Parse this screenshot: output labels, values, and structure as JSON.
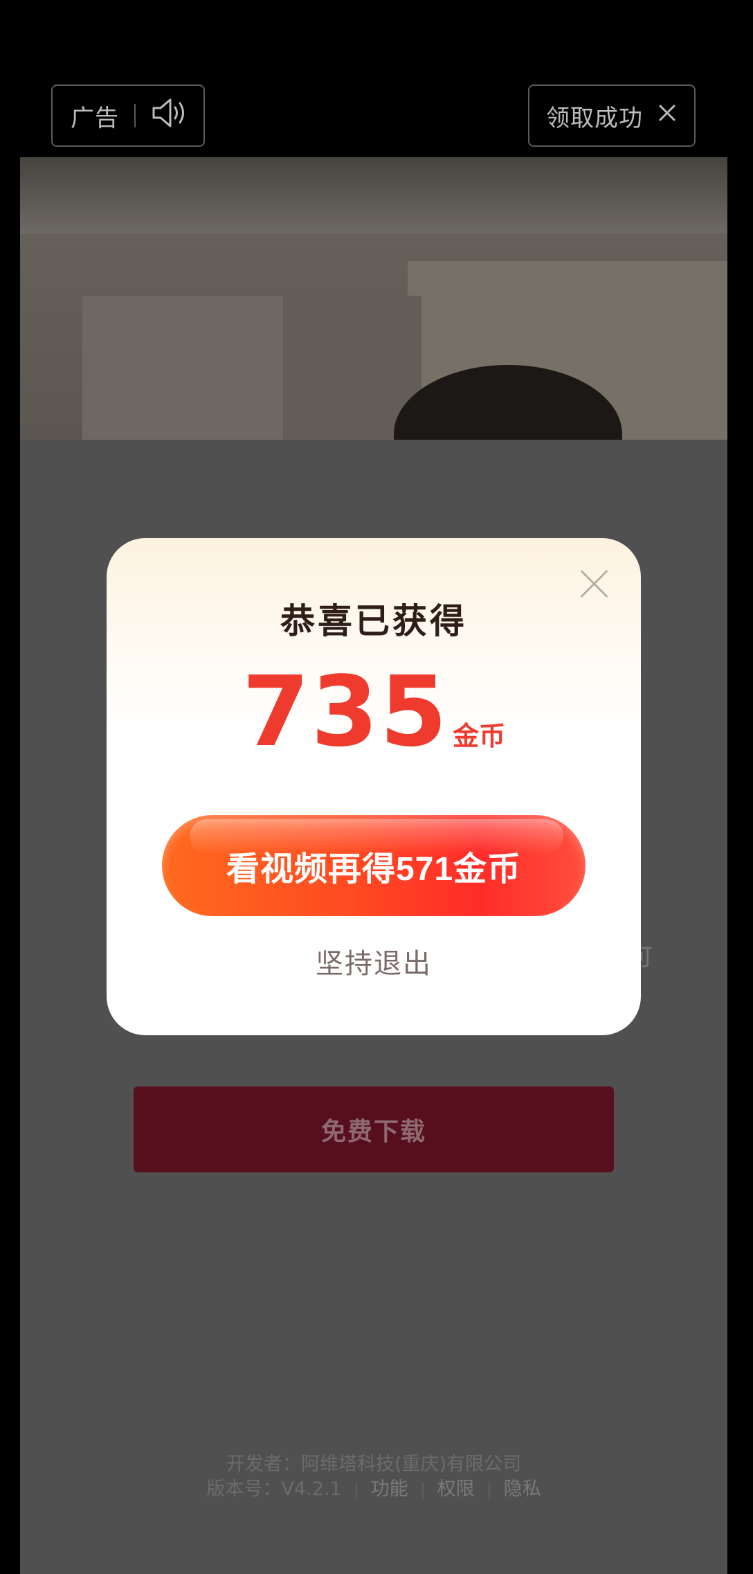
{
  "topbar": {
    "ad_label": "广告",
    "sound_icon": "speaker-icon",
    "claim_label": "领取成功",
    "close_icon": "close-icon"
  },
  "background": {
    "download_label": "免费下载",
    "side_mark": "可",
    "footer": {
      "developer": "开发者：阿维塔科技(重庆)有限公司",
      "version": "版本号：V4.2.1",
      "features": "功能",
      "permissions": "权限",
      "privacy": "隐私"
    }
  },
  "dialog": {
    "title": "恭喜已获得",
    "amount": "735",
    "unit": "金币",
    "cta_label": "看视频再得571金币",
    "exit_label": "坚持退出",
    "close_icon": "close-icon"
  },
  "colors": {
    "accent": "#ef3b2e",
    "cta_start": "#ff6a1e",
    "cta_end": "#ff2c28",
    "download_bg": "#570f1e"
  }
}
